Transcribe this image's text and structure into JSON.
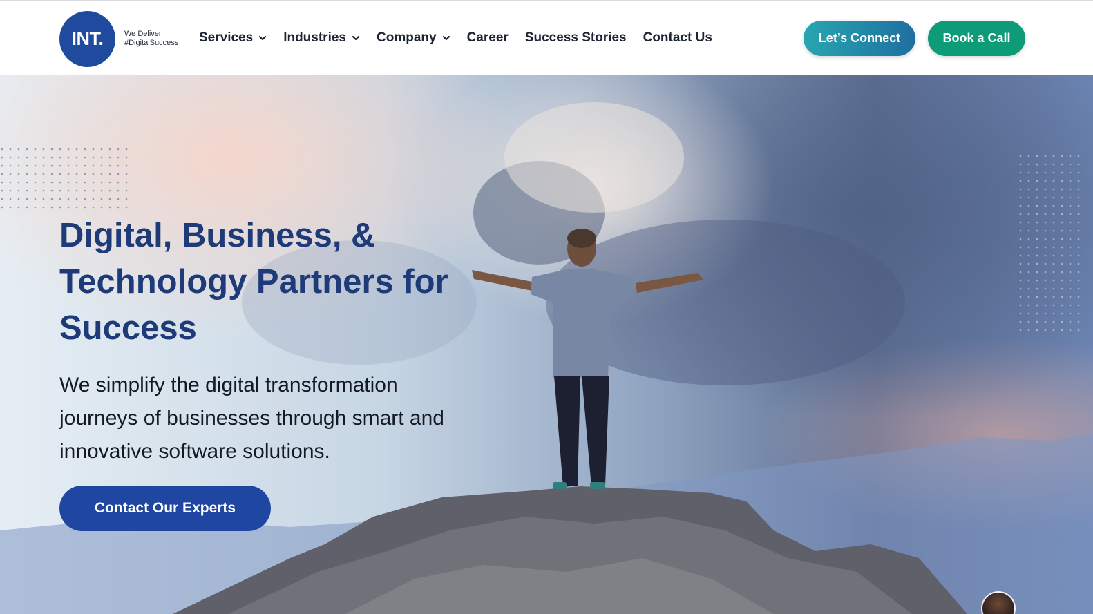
{
  "header": {
    "logo": {
      "mark": "INT.",
      "tagline_line1": "We Deliver",
      "tagline_line2": "#DigitalSuccess"
    },
    "nav": [
      {
        "label": "Services",
        "has_dropdown": true,
        "icon": "chevron-down-icon"
      },
      {
        "label": "Industries",
        "has_dropdown": true,
        "icon": "chevron-down-icon"
      },
      {
        "label": "Company",
        "has_dropdown": true,
        "icon": "chevron-down-icon"
      },
      {
        "label": "Career",
        "has_dropdown": false
      },
      {
        "label": "Success Stories",
        "has_dropdown": false
      },
      {
        "label": "Contact Us",
        "has_dropdown": false
      }
    ],
    "connect_label": "Let’s Connect",
    "book_label": "Book a Call"
  },
  "hero": {
    "title_line1": "Digital, Business, &",
    "title_line2": "Technology Partners for",
    "title_line3": "Success",
    "subtitle_line1": "We simplify the digital transformation",
    "subtitle_line2": "journeys of businesses through smart and",
    "subtitle_line3": "innovative software solutions.",
    "cta_label": "Contact Our Experts",
    "background_image": "person with outstretched arms standing on a rocky mountain summit against a cloudy sky"
  },
  "chat_widget": {
    "icon": "chat-avatar-icon"
  },
  "colors": {
    "brand_blue": "#1f4a9e",
    "title_blue": "#1e3a78",
    "cta_blue": "#1f46a0",
    "connect_teal_start": "#27a6b0",
    "connect_teal_end": "#1f6fa0",
    "book_green": "#0e9b78",
    "nav_text": "#1c2433"
  }
}
